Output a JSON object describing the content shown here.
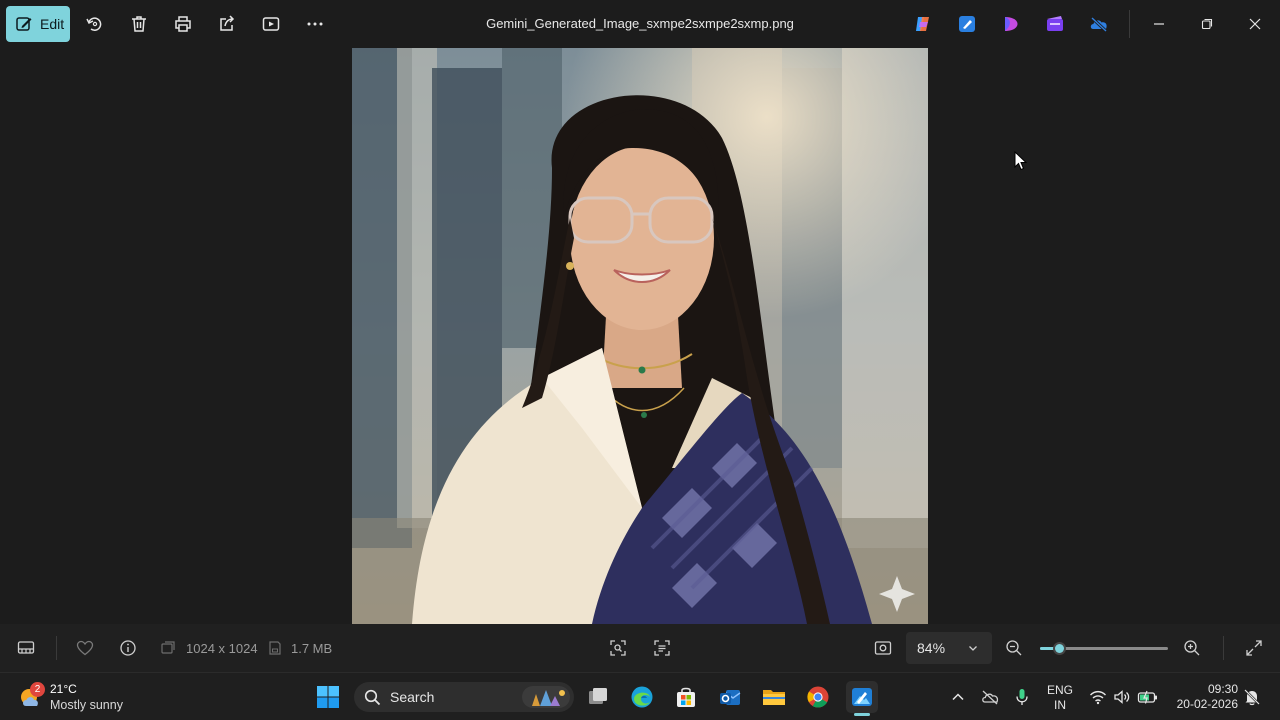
{
  "toolbar": {
    "edit_label": "Edit",
    "file_title": "Gemini_Generated_Image_sxmpe2sxmpe2sxmp.png"
  },
  "status": {
    "dimensions": "1024 x 1024",
    "file_size": "1.7 MB",
    "zoom_level": "84%",
    "zoom_slider_fraction": 0.15
  },
  "taskbar": {
    "weather_badge": "2",
    "weather_temp": "21°C",
    "weather_condition": "Mostly sunny",
    "search_label": "Search",
    "lang_line1": "ENG",
    "lang_line2": "IN",
    "time": "09:30",
    "date": "20-02-2026"
  },
  "colors": {
    "accent": "#7fd3dc",
    "background": "#1c1c1c",
    "statusbar": "#202020",
    "taskbar": "#1f1f1f"
  }
}
